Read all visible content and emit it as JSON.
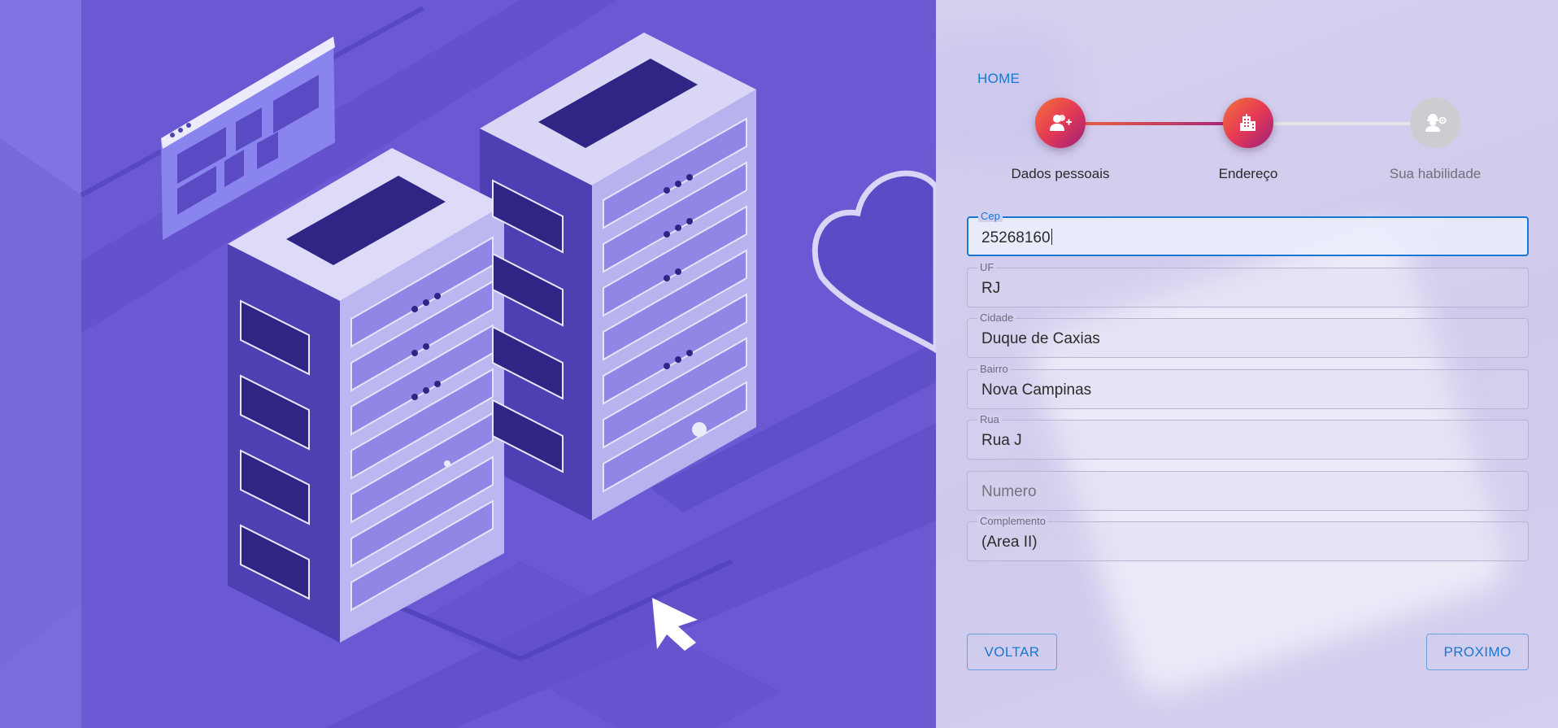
{
  "nav": {
    "home_label": "HOME"
  },
  "stepper": {
    "steps": [
      {
        "label": "Dados pessoais",
        "icon": "person-add-icon",
        "state": "completed"
      },
      {
        "label": "Endereço",
        "icon": "building-icon",
        "state": "active"
      },
      {
        "label": "Sua habilidade",
        "icon": "engineer-icon",
        "state": "inactive"
      }
    ]
  },
  "form": {
    "cep": {
      "label": "Cep",
      "value": "25268160"
    },
    "uf": {
      "label": "UF",
      "value": "RJ"
    },
    "cidade": {
      "label": "Cidade",
      "value": "Duque de Caxias"
    },
    "bairro": {
      "label": "Bairro",
      "value": "Nova Campinas"
    },
    "rua": {
      "label": "Rua",
      "value": "Rua J"
    },
    "numero": {
      "placeholder": "Numero",
      "value": ""
    },
    "complemento": {
      "label": "Complemento",
      "value": "(Area II)"
    }
  },
  "actions": {
    "back_label": "VOLTAR",
    "next_label": "PROXIMO"
  },
  "colors": {
    "accent": "#1976d2",
    "step_gradient_start": "#f2713a",
    "step_gradient_end": "#9b1f7a",
    "hero_bg": "#6a59d3"
  }
}
